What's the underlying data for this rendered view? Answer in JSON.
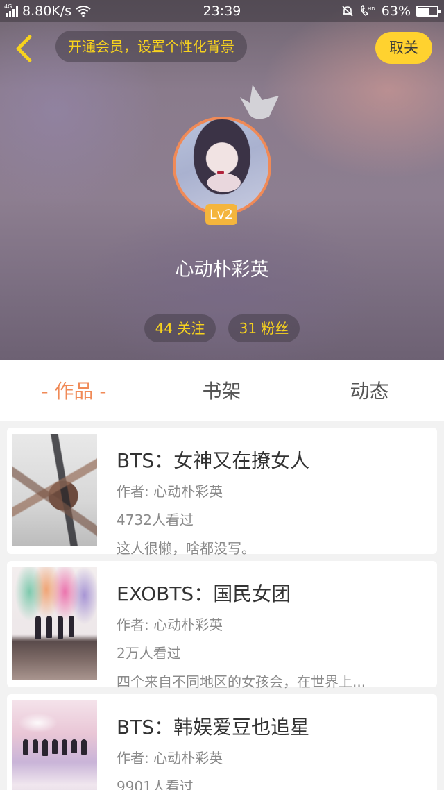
{
  "status_bar": {
    "network": "4G",
    "speed": "8.80K/s",
    "time": "23:39",
    "battery": "63%",
    "battery_level": 0.63
  },
  "header": {
    "vip_promo": "开通会员，设置个性化背景",
    "unfollow_label": "取关",
    "level_badge": "Lv2",
    "username": "心动朴彩英",
    "following": "44 关注",
    "fans": "31 粉丝"
  },
  "tabs": [
    {
      "label": "- 作品 -",
      "active": true
    },
    {
      "label": "书架",
      "active": false
    },
    {
      "label": "动态",
      "active": false
    }
  ],
  "works": [
    {
      "title": "BTS：女神又在撩女人",
      "author": "作者: 心动朴彩英",
      "views": "4732人看过",
      "description": "这人很懒，啥都没写。"
    },
    {
      "title": "EXOBTS：国民女团",
      "author": "作者: 心动朴彩英",
      "views": "2万人看过",
      "description": "四个来自不同地区的女孩会，在世界上..."
    },
    {
      "title": "BTS：韩娱爱豆也追星",
      "author": "作者: 心动朴彩英",
      "views": "9901人看过",
      "description": ""
    }
  ],
  "colors": {
    "accent": "#f08a57",
    "highlight_yellow": "#f7d21e",
    "unfollow_button": "#ffd22f",
    "level_badge": "#f4b53d"
  },
  "icons": {
    "back": "chevron-left-icon",
    "crown": "crown-icon",
    "wifi": "wifi-icon",
    "mute": "mute-bell-icon",
    "call": "hd-call-icon"
  }
}
